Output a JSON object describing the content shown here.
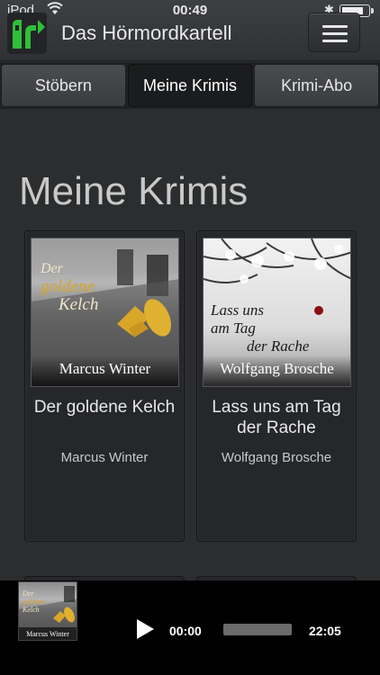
{
  "status_bar": {
    "carrier": "iPod",
    "time": "00:49",
    "battery_level": 0.8
  },
  "header": {
    "app_title": "Das Hörmordkartell",
    "menu_icon": "hamburger-menu-icon"
  },
  "tabs": [
    {
      "label": "Stöbern",
      "active": false
    },
    {
      "label": "Meine Krimis",
      "active": true
    },
    {
      "label": "Krimi-Abo",
      "active": false
    }
  ],
  "main": {
    "page_title": "Meine Krimis",
    "books": [
      {
        "title": "Der goldene Kelch",
        "author": "Marcus Winter",
        "cover_title_lines": [
          "Der",
          "goldene",
          "Kelch"
        ],
        "cover_author": "Marcus Winter"
      },
      {
        "title": "Lass uns am Tag der Rache",
        "author": "Wolfgang Brosche",
        "cover_title_lines": [
          "Lass uns",
          "am Tag",
          "der Rache"
        ],
        "cover_author": "Wolfgang Brosche"
      }
    ]
  },
  "player": {
    "cover_title_lines": [
      "Der",
      "goldene",
      "Kelch"
    ],
    "cover_author": "Marcus Winter",
    "current_time": "00:00",
    "total_time": "22:05",
    "progress": 0.0
  },
  "colors": {
    "background": "#2b2d2f",
    "tab_active": "#1b1c1e",
    "gold": "#d8a628"
  }
}
